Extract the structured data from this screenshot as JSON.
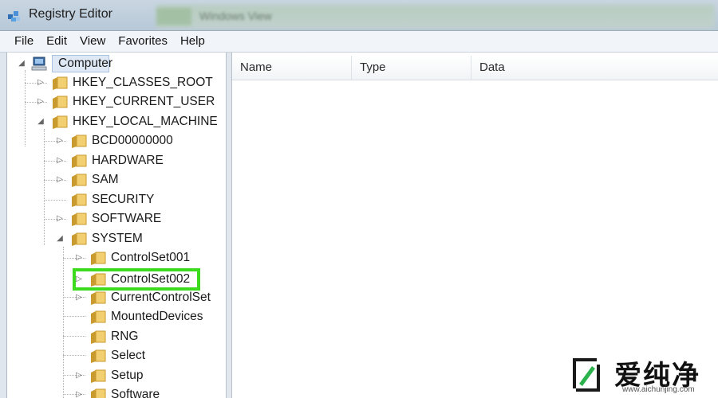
{
  "window": {
    "title": "Registry Editor",
    "background_window_title": "Windows View"
  },
  "menu": [
    "File",
    "Edit",
    "View",
    "Favorites",
    "Help"
  ],
  "tree": {
    "root": "Computer",
    "hives": [
      "HKEY_CLASSES_ROOT",
      "HKEY_CURRENT_USER",
      "HKEY_LOCAL_MACHINE"
    ],
    "hklm_children": [
      "BCD00000000",
      "HARDWARE",
      "SAM",
      "SECURITY",
      "SOFTWARE",
      "SYSTEM"
    ],
    "system_children": [
      "ControlSet001",
      "ControlSet002",
      "CurrentControlSet",
      "MountedDevices",
      "RNG",
      "Select",
      "Setup",
      "Software"
    ],
    "highlighted_key": "ControlSet002"
  },
  "list": {
    "columns": [
      "Name",
      "Type",
      "Data"
    ]
  },
  "watermark": {
    "brand": "爱纯净",
    "url": "www.aichunjing.com"
  },
  "colors": {
    "highlight_border": "#3ddb1d",
    "folder": "#e8c15a",
    "selection": "#dfe9f5"
  }
}
